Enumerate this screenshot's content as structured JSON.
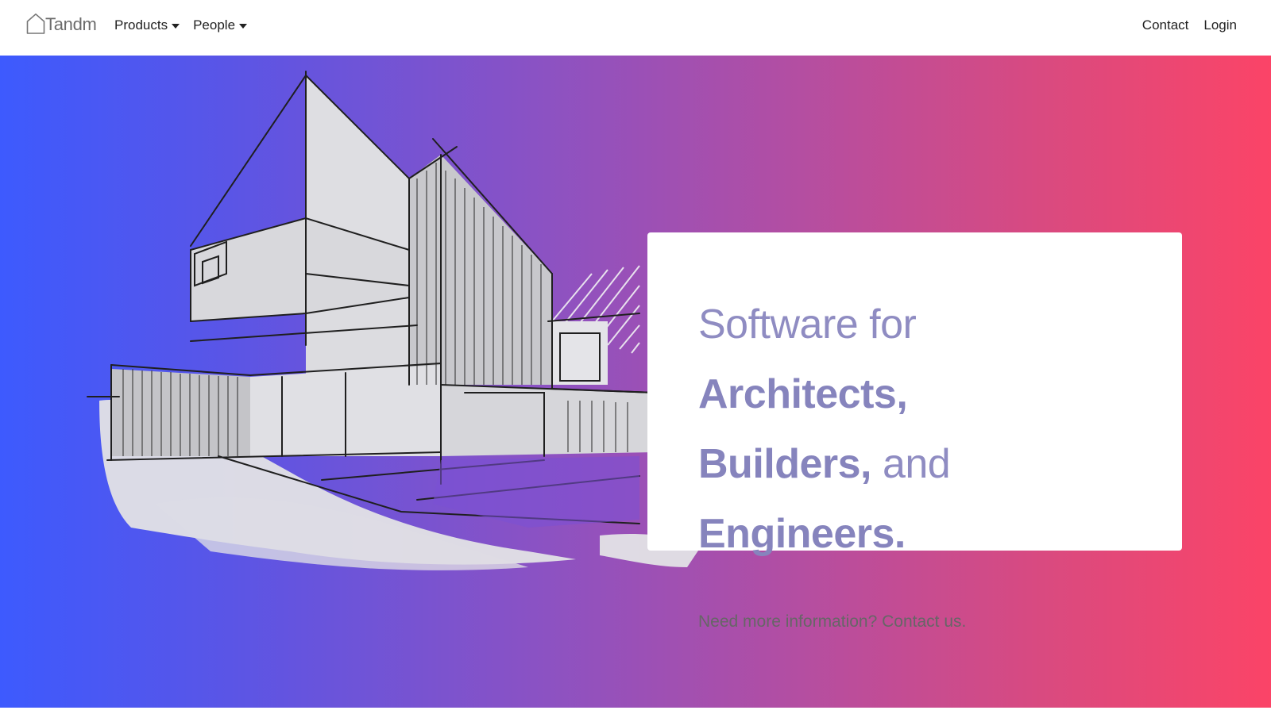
{
  "nav": {
    "brand": "Tandm",
    "brand_icon": "house-icon",
    "left_items": [
      {
        "label": "Products",
        "has_dropdown": true
      },
      {
        "label": "People",
        "has_dropdown": true
      }
    ],
    "right_items": [
      {
        "label": "Contact"
      },
      {
        "label": "Login"
      }
    ]
  },
  "hero": {
    "gradient_colors": [
      "#3d5afe",
      "#fb4467"
    ],
    "illustration": "architectural-building-sketch",
    "headline": {
      "part1": "Software for ",
      "em1": "Architects,",
      "em2": "Builders,",
      "part2": " and ",
      "em3": "Engineers."
    },
    "info_text": "Need more information? ",
    "info_link": "Contact us."
  }
}
